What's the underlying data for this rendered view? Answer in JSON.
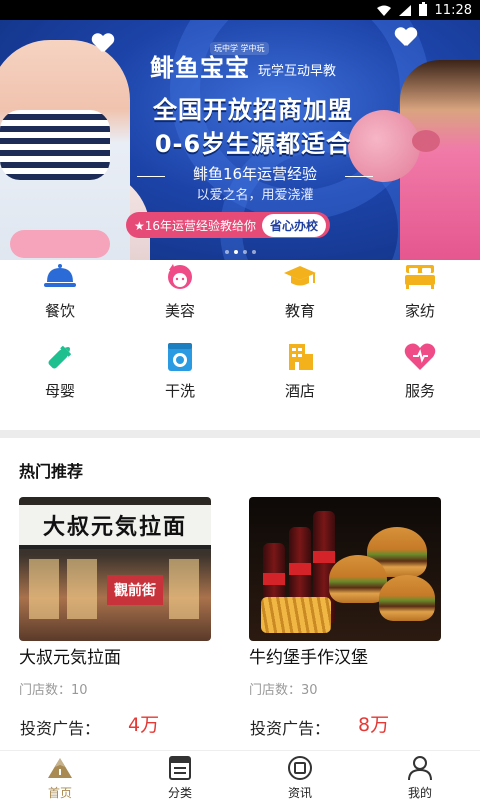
{
  "status_bar": {
    "time": "11:28"
  },
  "banner": {
    "brand_tag": "玩中学 学中玩",
    "brand_name": "鲱鱼宝宝",
    "brand_slogan": "玩学互动早教",
    "headline_1": "全国开放招商加盟",
    "headline_2": "0-6岁生源都适合",
    "subline_1": "鲱鱼16年运营经验",
    "subline_2": "以爱之名，用爱浇灌",
    "pill_text": "★16年运营经验教给你",
    "pill_button": "省心办校",
    "dots_count": 4,
    "active_dot": 1
  },
  "categories": [
    {
      "label": "餐饮",
      "icon": "cloche-icon",
      "color": "#2a6bd8"
    },
    {
      "label": "美容",
      "icon": "beauty-face-icon",
      "color": "#ef4b86"
    },
    {
      "label": "教育",
      "icon": "graduation-cap-icon",
      "color": "#f3b21c"
    },
    {
      "label": "家纺",
      "icon": "bed-icon",
      "color": "#f3b21c"
    },
    {
      "label": "母婴",
      "icon": "baby-bottle-icon",
      "color": "#1fbf8f"
    },
    {
      "label": "干洗",
      "icon": "washing-machine-icon",
      "color": "#2a9be3"
    },
    {
      "label": "酒店",
      "icon": "hotel-building-icon",
      "color": "#f3b21c"
    },
    {
      "label": "服务",
      "icon": "heart-icon",
      "color": "#ef4b86"
    }
  ],
  "hot": {
    "title": "热门推荐",
    "items": [
      {
        "name": "大叔元気拉面",
        "stores": "门店数：10",
        "invest_label": "投资广告：",
        "invest_value": "4万",
        "sign_text": "大叔元気拉面",
        "red_sign": "觀前街"
      },
      {
        "name": "牛约堡手作汉堡",
        "stores": "门店数：30",
        "invest_label": "投资广告：",
        "invest_value": "8万"
      }
    ]
  },
  "bottom_nav": [
    {
      "label": "首页",
      "icon": "home-mountain-icon",
      "active": true
    },
    {
      "label": "分类",
      "icon": "category-list-icon",
      "active": false
    },
    {
      "label": "资讯",
      "icon": "news-circle-icon",
      "active": false
    },
    {
      "label": "我的",
      "icon": "user-icon",
      "active": false
    }
  ],
  "colors": {
    "accent": "#a88a52",
    "price": "#e53935",
    "banner_blue": "#1c43a8"
  }
}
